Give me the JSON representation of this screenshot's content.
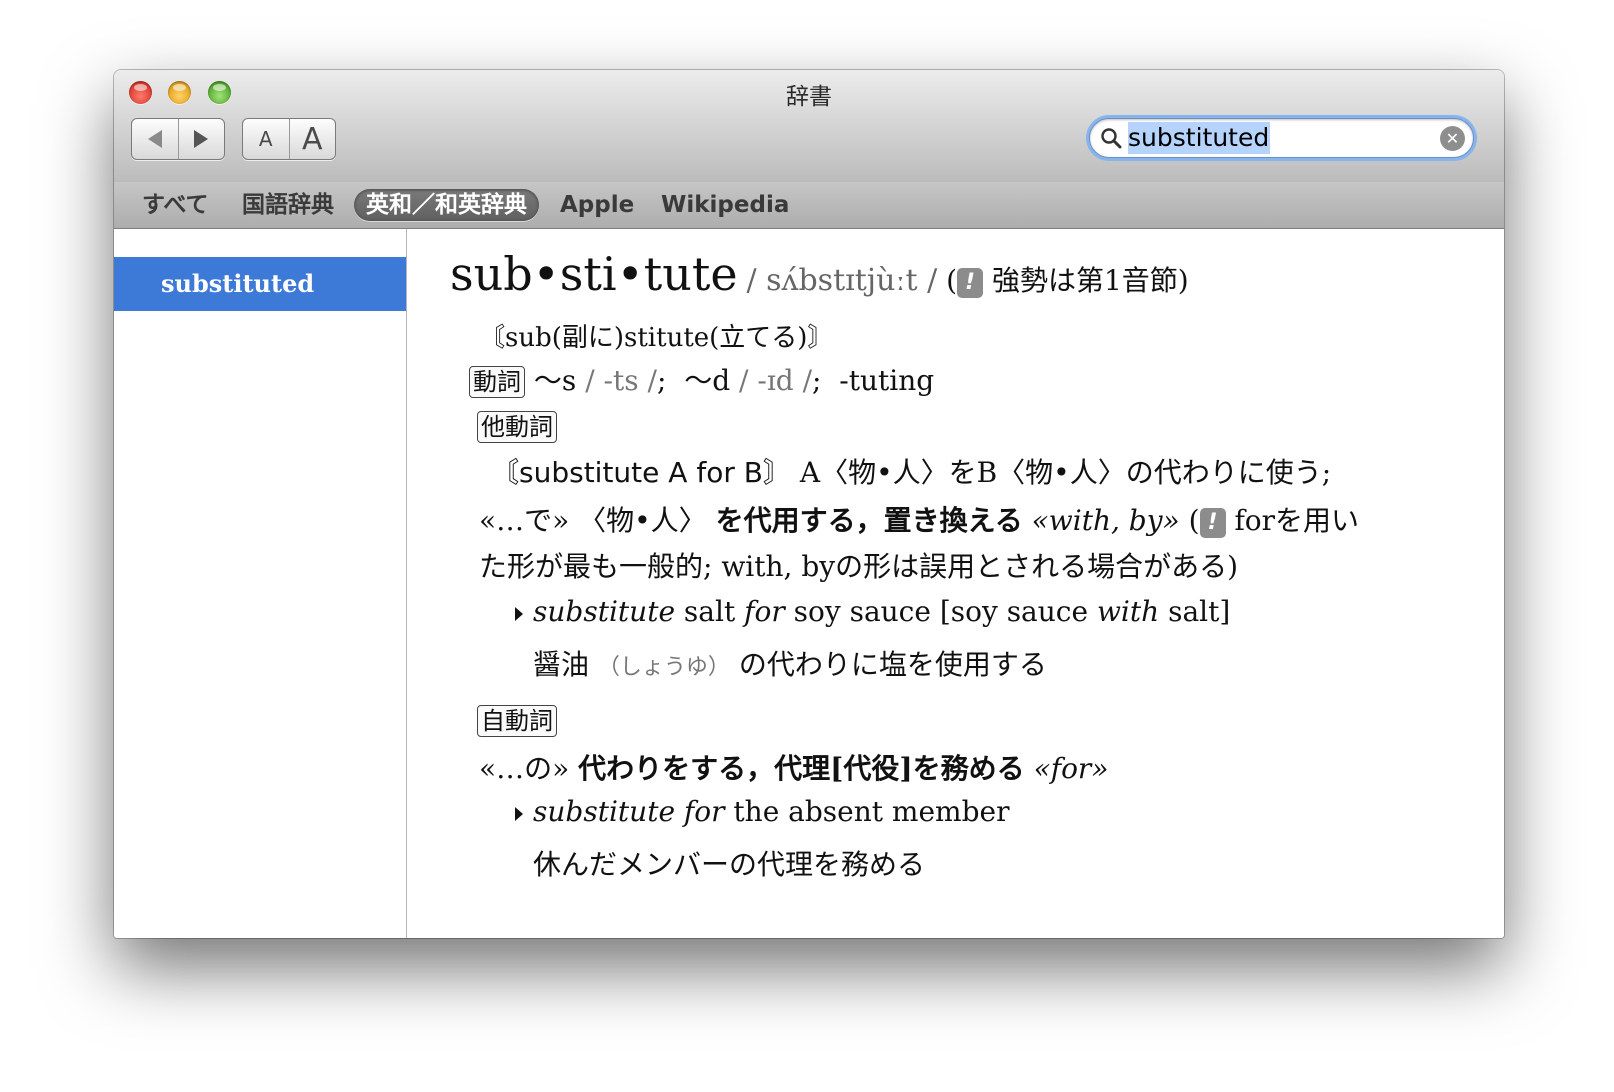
{
  "window": {
    "title": "辞書"
  },
  "toolbar": {
    "back_icon": "triangle-left-icon",
    "forward_icon": "triangle-right-icon",
    "font_small_label": "A",
    "font_large_label": "A"
  },
  "search": {
    "value": "substituted",
    "placeholder": ""
  },
  "tabs": [
    {
      "label": "すべて"
    },
    {
      "label": "国語辞典"
    },
    {
      "label": "英和／和英辞典",
      "selected": true
    },
    {
      "label": "Apple"
    },
    {
      "label": "Wikipedia"
    }
  ],
  "sidebar": {
    "items": [
      {
        "label": "substituted",
        "selected": true
      }
    ]
  },
  "entry": {
    "headword": "sub•sti•tute",
    "pron": "/ sʌ́bstɪtjùːt /",
    "stress_open": "(",
    "stress_note": "強勢は第1音節)",
    "bang": "!",
    "etymology": "〘sub(副に)stitute(立てる)〙",
    "pos_verb": "動詞",
    "infl_1": "〜s",
    "infl_1_pron": "/ -ts /",
    "sep": ";",
    "infl_2": "〜d",
    "infl_2_pron": "/ -ɪd /",
    "infl_3": "-tuting",
    "transitive": {
      "label": "他動詞",
      "pattern": "〘substitute A for B〙",
      "def_line1_rest": "A〈物•人〉をB〈物•人〉の代わりに使う;",
      "def_line2_pre": "«…で» 〈物•人〉",
      "def_line2_bold": "を代用する，置き換える",
      "def_line2_prep": "«with, by»",
      "def_line2_paren": "(",
      "def_line2_note": "forを用い",
      "def_line3": "た形が最も一般的; with, byの形は誤用とされる場合がある)",
      "example_en_1": "substitute",
      "example_en_2": "salt",
      "example_en_3": "for",
      "example_en_4": "soy sauce [soy sauce",
      "example_en_5": "with",
      "example_en_6": "salt]",
      "example_ja_1": "醤油",
      "example_ja_ruby": "（しょうゆ）",
      "example_ja_2": "の代わりに塩を使用する"
    },
    "intransitive": {
      "label": "自動詞",
      "def_pre": "«…の»",
      "def_bold": "代わりをする，代理[代役]を務める",
      "def_prep": "«for»",
      "example_en_1": "substitute for",
      "example_en_2": "the absent member",
      "example_ja": "休んだメンバーの代理を務める"
    }
  }
}
